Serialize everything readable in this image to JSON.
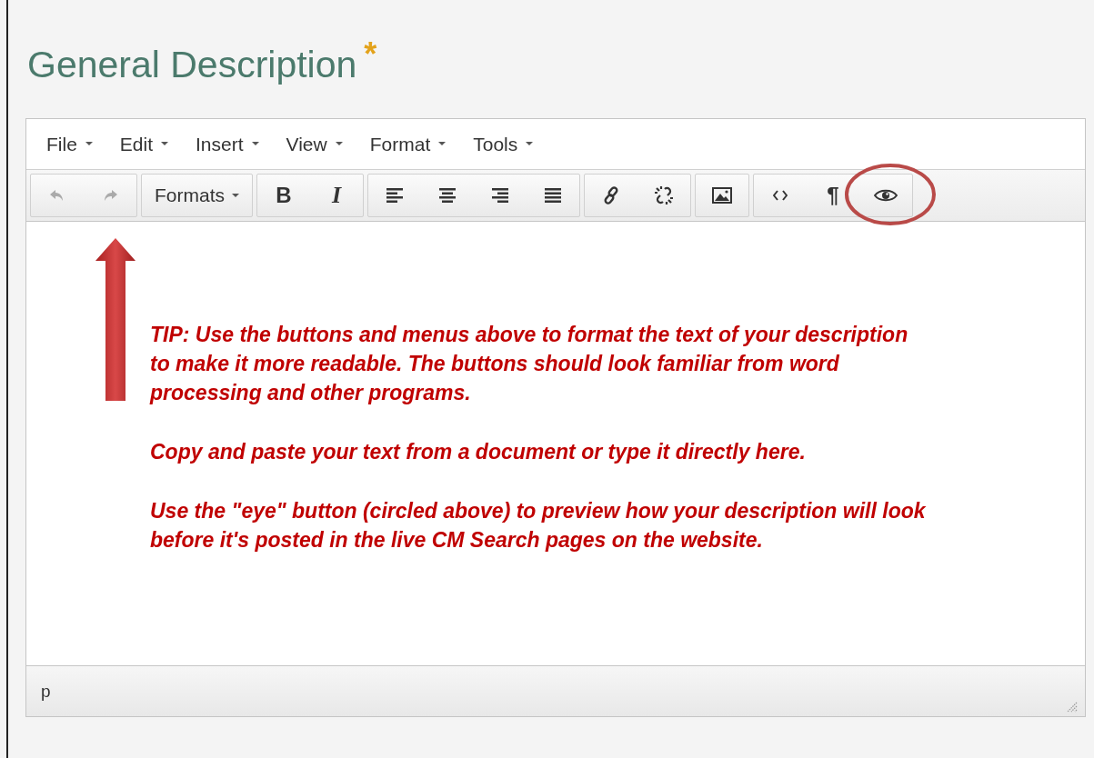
{
  "field": {
    "label": "General Description",
    "required_mark": "*"
  },
  "menubar": [
    {
      "label": "File"
    },
    {
      "label": "Edit"
    },
    {
      "label": "Insert"
    },
    {
      "label": "View"
    },
    {
      "label": "Format"
    },
    {
      "label": "Tools"
    }
  ],
  "toolbar": [
    {
      "buttons": [
        {
          "kind": "undo",
          "disabled": true
        },
        {
          "kind": "redo",
          "disabled": true
        }
      ]
    },
    {
      "buttons": [
        {
          "kind": "dropdown",
          "label": "Formats"
        }
      ]
    },
    {
      "buttons": [
        {
          "kind": "bold",
          "label": "B"
        },
        {
          "kind": "italic",
          "label": "I"
        }
      ]
    },
    {
      "buttons": [
        {
          "kind": "alignleft"
        },
        {
          "kind": "aligncenter"
        },
        {
          "kind": "alignright"
        },
        {
          "kind": "justify"
        }
      ]
    },
    {
      "buttons": [
        {
          "kind": "link"
        },
        {
          "kind": "unlink"
        }
      ]
    },
    {
      "buttons": [
        {
          "kind": "image"
        }
      ]
    },
    {
      "buttons": [
        {
          "kind": "code"
        },
        {
          "kind": "glyph",
          "label": "¶"
        },
        {
          "kind": "preview",
          "highlighted": true
        }
      ]
    }
  ],
  "tip": [
    "TIP: Use the buttons and menus above to format the text of your description to make it more readable. The buttons should look familiar from word processing and other programs.",
    "Copy and paste your text from a document or type it directly here.",
    "Use the \"eye\" button (circled above) to preview how your description will look before it's posted in the live CM Search pages on the website."
  ],
  "status_bar": {
    "path": "p"
  }
}
